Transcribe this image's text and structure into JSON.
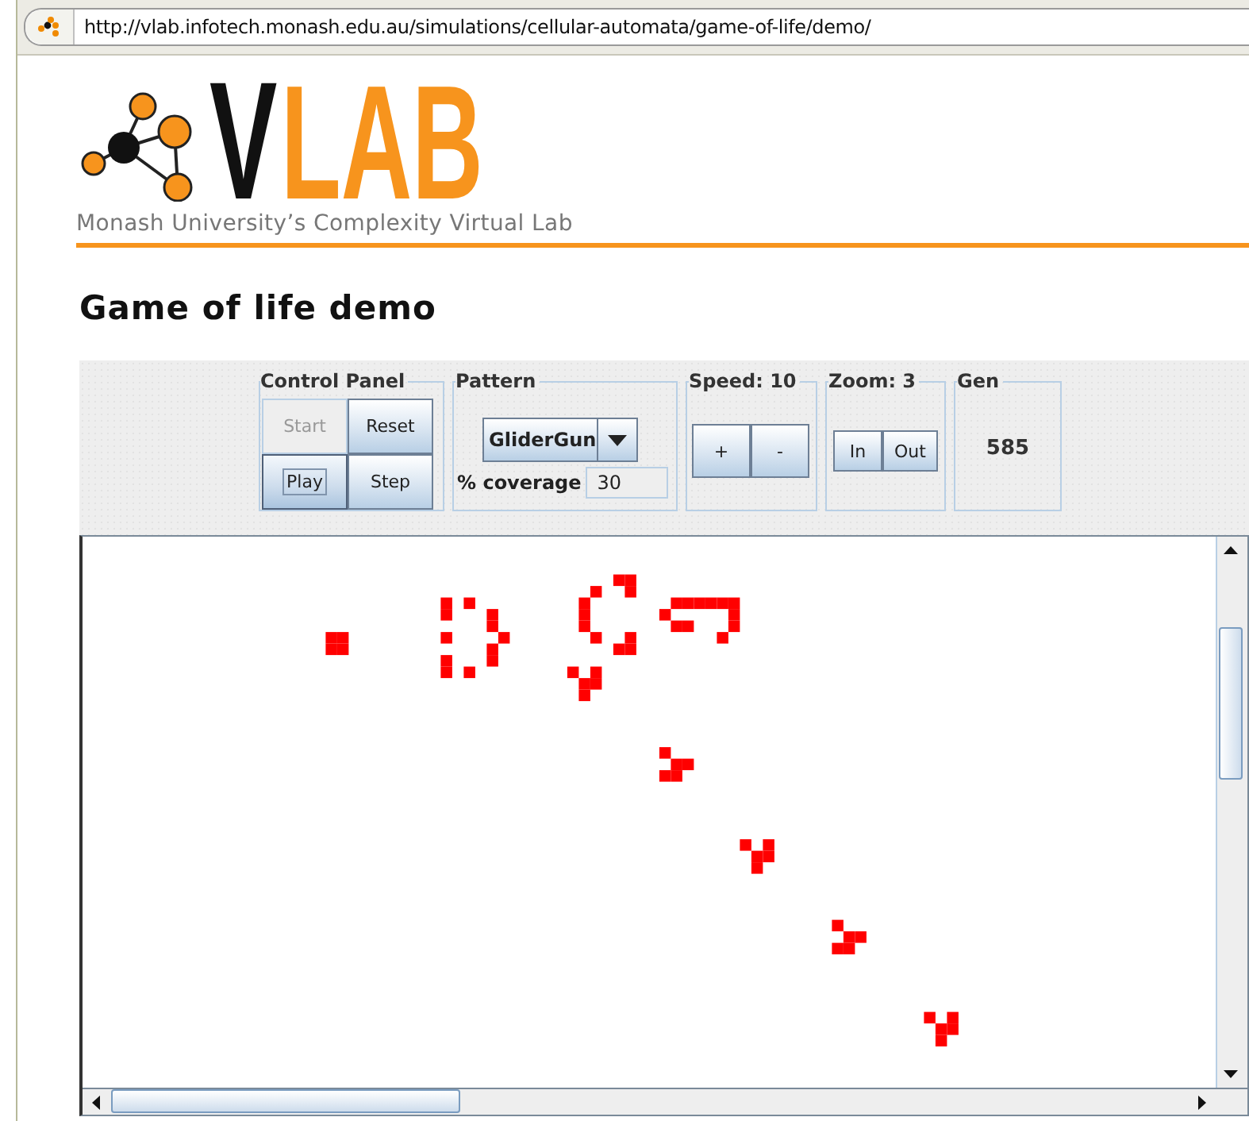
{
  "address_bar": {
    "url": "http://vlab.infotech.monash.edu.au/simulations/cellular-automata/game-of-life/demo/"
  },
  "header": {
    "logo_dark": "V",
    "logo_light": "LAB",
    "tagline": "Monash University’s Complexity Virtual Lab"
  },
  "title": "Game of life demo",
  "applet": {
    "control_panel": {
      "title": "Control Panel",
      "buttons": [
        {
          "label": "Start",
          "disabled": true,
          "focused": false
        },
        {
          "label": "Reset",
          "disabled": false,
          "focused": false
        },
        {
          "label": "Play",
          "disabled": false,
          "focused": true
        },
        {
          "label": "Step",
          "disabled": false,
          "focused": false
        }
      ]
    },
    "pattern": {
      "title": "Pattern",
      "value": "GliderGun",
      "coverage_label": "% coverage",
      "coverage_value": "30"
    },
    "speed": {
      "title": "Speed: 10",
      "buttons": [
        "+",
        "-"
      ]
    },
    "zoom": {
      "title": "Zoom: 3",
      "buttons": [
        "In",
        "Out"
      ]
    },
    "generation": {
      "title": "Gen",
      "value": "585"
    }
  }
}
